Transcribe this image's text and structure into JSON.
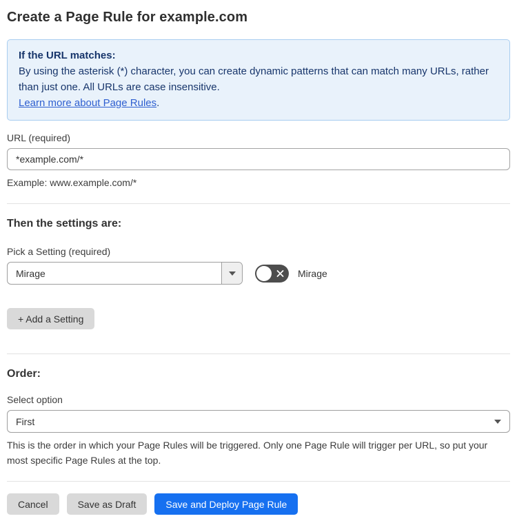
{
  "page": {
    "title": "Create a Page Rule for example.com"
  },
  "info_box": {
    "heading": "If the URL matches:",
    "body": "By using the asterisk (*) character, you can create dynamic patterns that can match many URLs, rather than just one. All URLs are case insensitive.",
    "link": "Learn more about Page Rules",
    "link_suffix": "."
  },
  "url_field": {
    "label": "URL (required)",
    "value": "*example.com/*",
    "help": "Example: www.example.com/*"
  },
  "settings_section": {
    "heading": "Then the settings are:",
    "setting_label": "Pick a Setting (required)",
    "setting_value": "Mirage",
    "toggle_label": "Mirage",
    "toggle_state": "off",
    "add_setting_label": "+ Add a Setting"
  },
  "order_section": {
    "heading": "Order:",
    "select_label": "Select option",
    "select_value": "First",
    "help": "This is the order in which your Page Rules will be triggered. Only one Page Rule will trigger per URL, so put your most specific Page Rules at the top."
  },
  "footer": {
    "cancel_label": "Cancel",
    "save_draft_label": "Save as Draft",
    "save_deploy_label": "Save and Deploy Page Rule"
  },
  "colors": {
    "accent_blue": "#1670f0",
    "info_bg": "#e9f2fb",
    "info_border": "#a8cdf0",
    "info_text": "#17356b",
    "link_blue": "#2e5fd0",
    "toggle_off_gray": "#4d4d4d",
    "button_gray": "#d9d9d9"
  }
}
